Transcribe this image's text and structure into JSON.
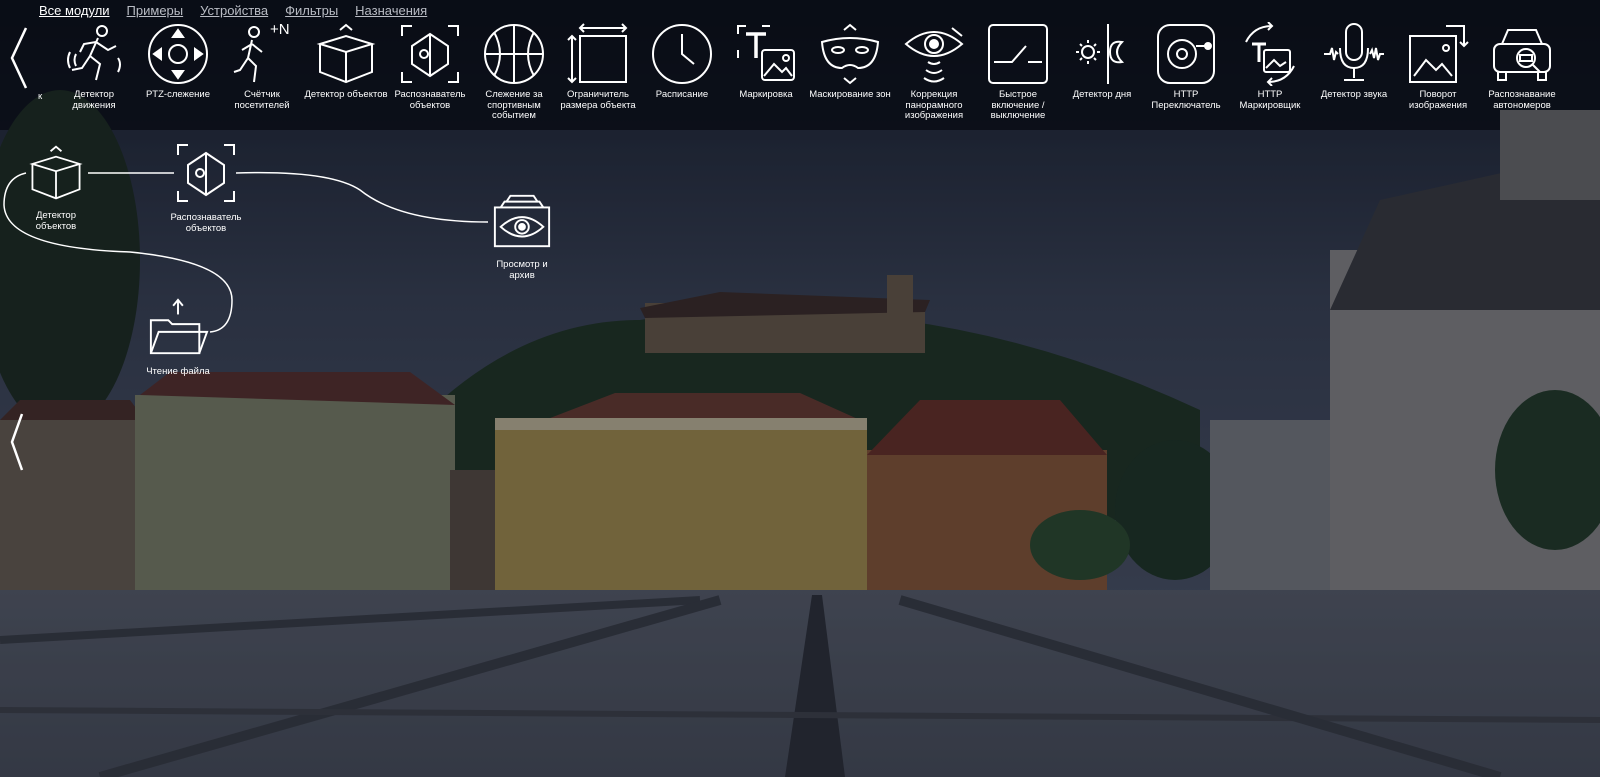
{
  "tabs": [
    {
      "label": "Все модули",
      "active": true
    },
    {
      "label": "Примеры",
      "active": false
    },
    {
      "label": "Устройства",
      "active": false
    },
    {
      "label": "Фильтры",
      "active": false
    },
    {
      "label": "Назначения",
      "active": false
    }
  ],
  "palette": {
    "first_label": "к",
    "items": [
      {
        "label": "Детектор движения",
        "icon": "running-man-icon"
      },
      {
        "label": "PTZ-слежение",
        "icon": "ptz-joystick-icon"
      },
      {
        "label": "Счётчик посетителей",
        "icon": "visitor-counter-icon",
        "badge": "+N"
      },
      {
        "label": "Детектор объектов",
        "icon": "box-icon"
      },
      {
        "label": "Распознаватель объектов",
        "icon": "object-recognizer-icon"
      },
      {
        "label": "Слежение за спортивным событием",
        "icon": "basketball-icon"
      },
      {
        "label": "Ограничитель размера объекта",
        "icon": "size-limiter-icon"
      },
      {
        "label": "Расписание",
        "icon": "clock-icon"
      },
      {
        "label": "Маркировка",
        "icon": "text-marker-icon"
      },
      {
        "label": "Маскирование зон",
        "icon": "mask-icon"
      },
      {
        "label": "Коррекция панорамного изображения",
        "icon": "eye-correction-icon"
      },
      {
        "label": "Быстрое включение / выключение",
        "icon": "switch-icon"
      },
      {
        "label": "Детектор дня",
        "icon": "day-night-icon"
      },
      {
        "label": "HTTP Переключатель",
        "icon": "http-switch-icon"
      },
      {
        "label": "HTTP Маркировщик",
        "icon": "http-marker-icon"
      },
      {
        "label": "Детектор звука",
        "icon": "microphone-icon"
      },
      {
        "label": "Поворот изображения",
        "icon": "rotate-image-icon"
      },
      {
        "label": "Распознавание автономеров",
        "icon": "car-plate-icon"
      }
    ]
  },
  "canvas": {
    "nodes": [
      {
        "label": "Детектор объектов",
        "icon": "box-icon"
      },
      {
        "label": "Распознаватель объектов",
        "icon": "object-recognizer-icon"
      },
      {
        "label": "Просмотр и архив",
        "icon": "view-archive-icon"
      },
      {
        "label": "Чтение файла",
        "icon": "upload-folder-icon"
      }
    ]
  },
  "colors": {
    "overlay": "#1b2233",
    "text": "#ffffff",
    "tab_inactive": "#b9bcc4"
  }
}
